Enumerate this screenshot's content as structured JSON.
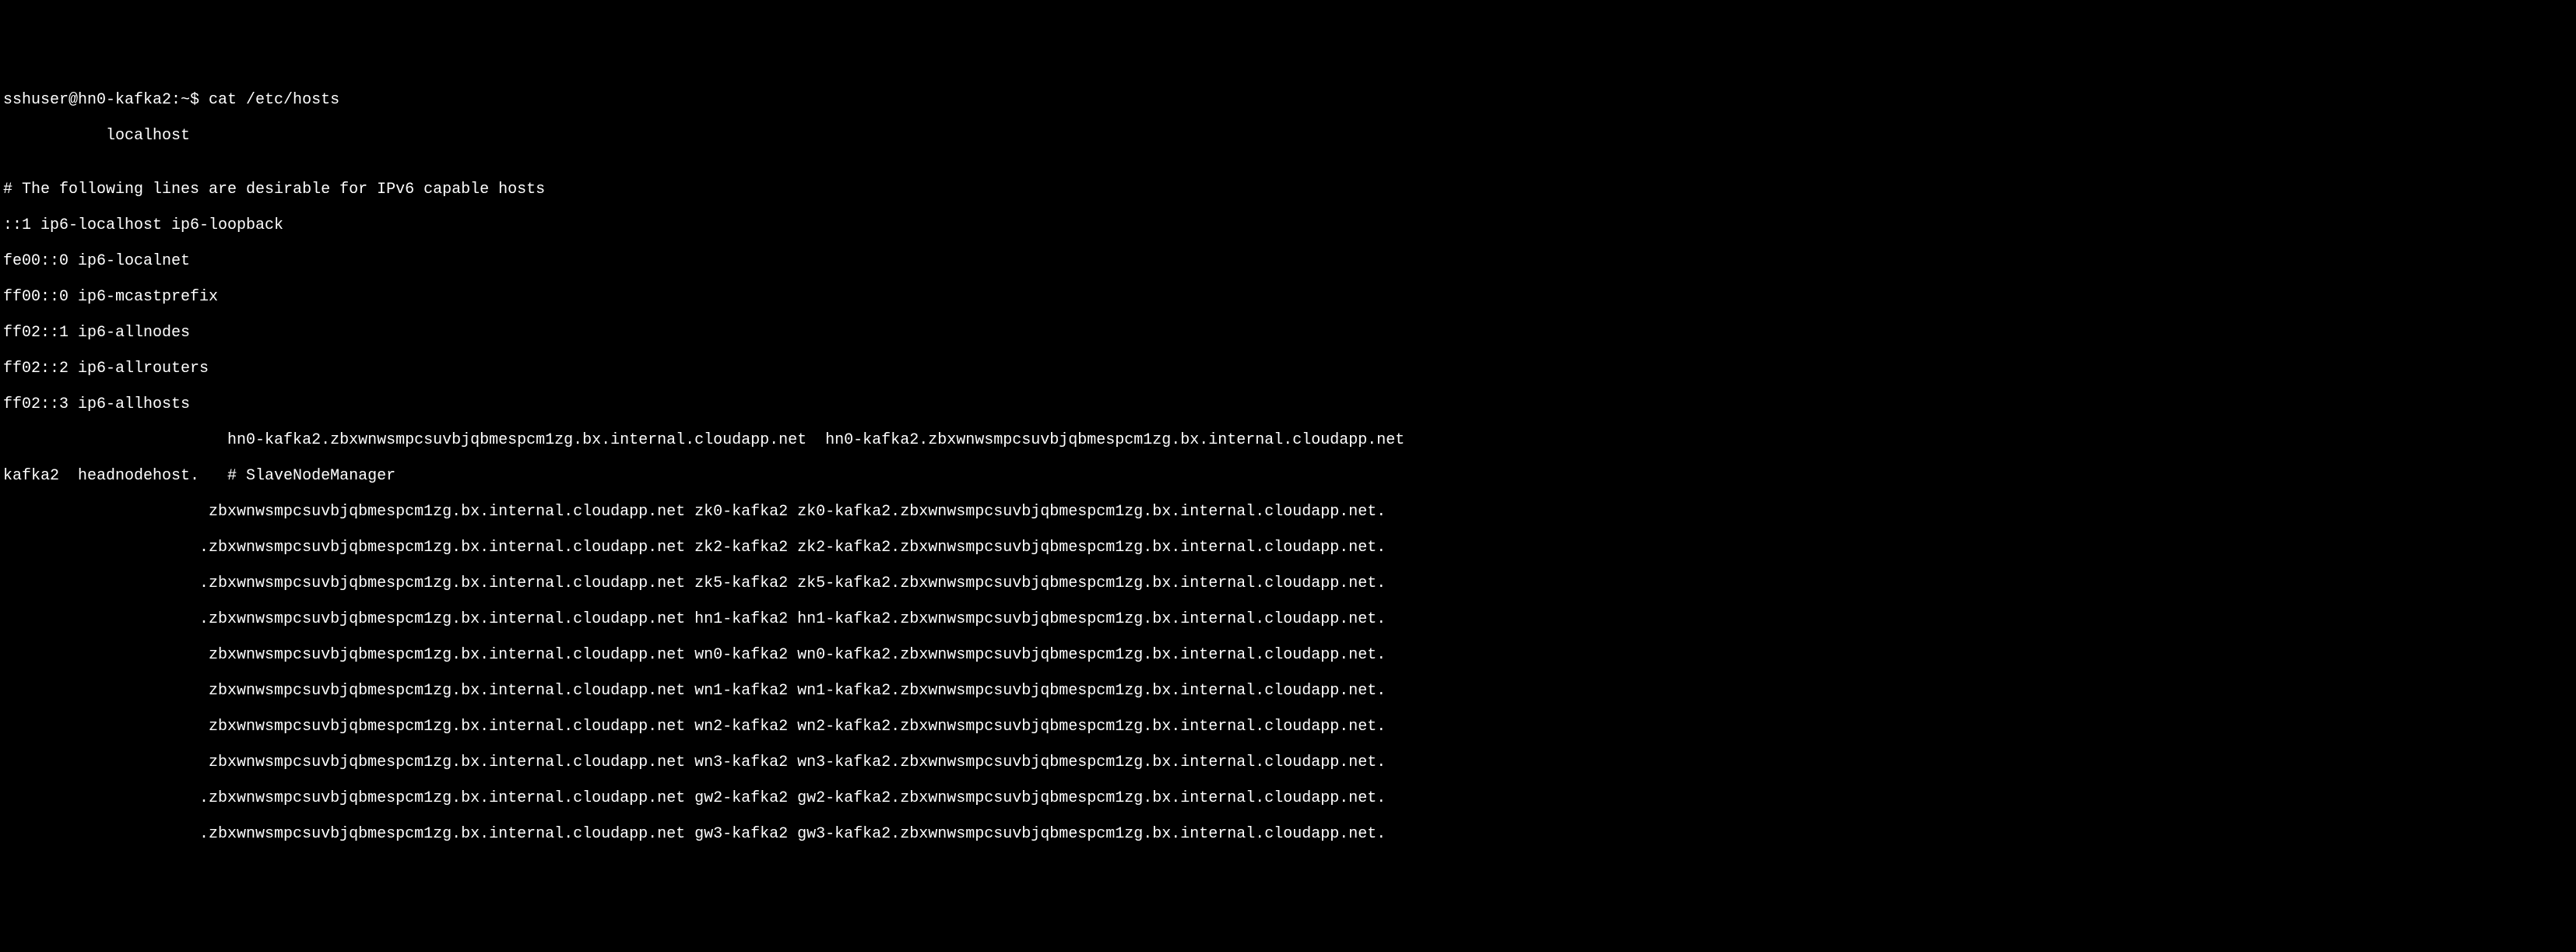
{
  "terminal": {
    "prompt": "sshuser@hn0-kafka2:~$ cat /etc/hosts",
    "localhost_line": "           localhost",
    "blank": "",
    "comment": "# The following lines are desirable for IPv6 capable hosts",
    "ipv6_1": "::1 ip6-localhost ip6-loopback",
    "ipv6_2": "fe00::0 ip6-localnet",
    "ipv6_3": "ff00::0 ip6-mcastprefix",
    "ipv6_4": "ff02::1 ip6-allnodes",
    "ipv6_5": "ff02::2 ip6-allrouters",
    "ipv6_6": "ff02::3 ip6-allhosts",
    "host_hn0": "                        hn0-kafka2.zbxwnwsmpcsuvbjqbmespcm1zg.bx.internal.cloudapp.net  hn0-kafka2.zbxwnwsmpcsuvbjqbmespcm1zg.bx.internal.cloudapp.net",
    "host_headnode": "kafka2  headnodehost.   # SlaveNodeManager",
    "entry_zk0": "                      zbxwnwsmpcsuvbjqbmespcm1zg.bx.internal.cloudapp.net zk0-kafka2 zk0-kafka2.zbxwnwsmpcsuvbjqbmespcm1zg.bx.internal.cloudapp.net.",
    "entry_zk2": "                     .zbxwnwsmpcsuvbjqbmespcm1zg.bx.internal.cloudapp.net zk2-kafka2 zk2-kafka2.zbxwnwsmpcsuvbjqbmespcm1zg.bx.internal.cloudapp.net.",
    "entry_zk5": "                     .zbxwnwsmpcsuvbjqbmespcm1zg.bx.internal.cloudapp.net zk5-kafka2 zk5-kafka2.zbxwnwsmpcsuvbjqbmespcm1zg.bx.internal.cloudapp.net.",
    "entry_hn1": "                     .zbxwnwsmpcsuvbjqbmespcm1zg.bx.internal.cloudapp.net hn1-kafka2 hn1-kafka2.zbxwnwsmpcsuvbjqbmespcm1zg.bx.internal.cloudapp.net.",
    "entry_wn0": "                      zbxwnwsmpcsuvbjqbmespcm1zg.bx.internal.cloudapp.net wn0-kafka2 wn0-kafka2.zbxwnwsmpcsuvbjqbmespcm1zg.bx.internal.cloudapp.net.",
    "entry_wn1": "                      zbxwnwsmpcsuvbjqbmespcm1zg.bx.internal.cloudapp.net wn1-kafka2 wn1-kafka2.zbxwnwsmpcsuvbjqbmespcm1zg.bx.internal.cloudapp.net.",
    "entry_wn2": "                      zbxwnwsmpcsuvbjqbmespcm1zg.bx.internal.cloudapp.net wn2-kafka2 wn2-kafka2.zbxwnwsmpcsuvbjqbmespcm1zg.bx.internal.cloudapp.net.",
    "entry_wn3": "                      zbxwnwsmpcsuvbjqbmespcm1zg.bx.internal.cloudapp.net wn3-kafka2 wn3-kafka2.zbxwnwsmpcsuvbjqbmespcm1zg.bx.internal.cloudapp.net.",
    "entry_gw2": "                     .zbxwnwsmpcsuvbjqbmespcm1zg.bx.internal.cloudapp.net gw2-kafka2 gw2-kafka2.zbxwnwsmpcsuvbjqbmespcm1zg.bx.internal.cloudapp.net.",
    "entry_gw3": "                     .zbxwnwsmpcsuvbjqbmespcm1zg.bx.internal.cloudapp.net gw3-kafka2 gw3-kafka2.zbxwnwsmpcsuvbjqbmespcm1zg.bx.internal.cloudapp.net."
  }
}
